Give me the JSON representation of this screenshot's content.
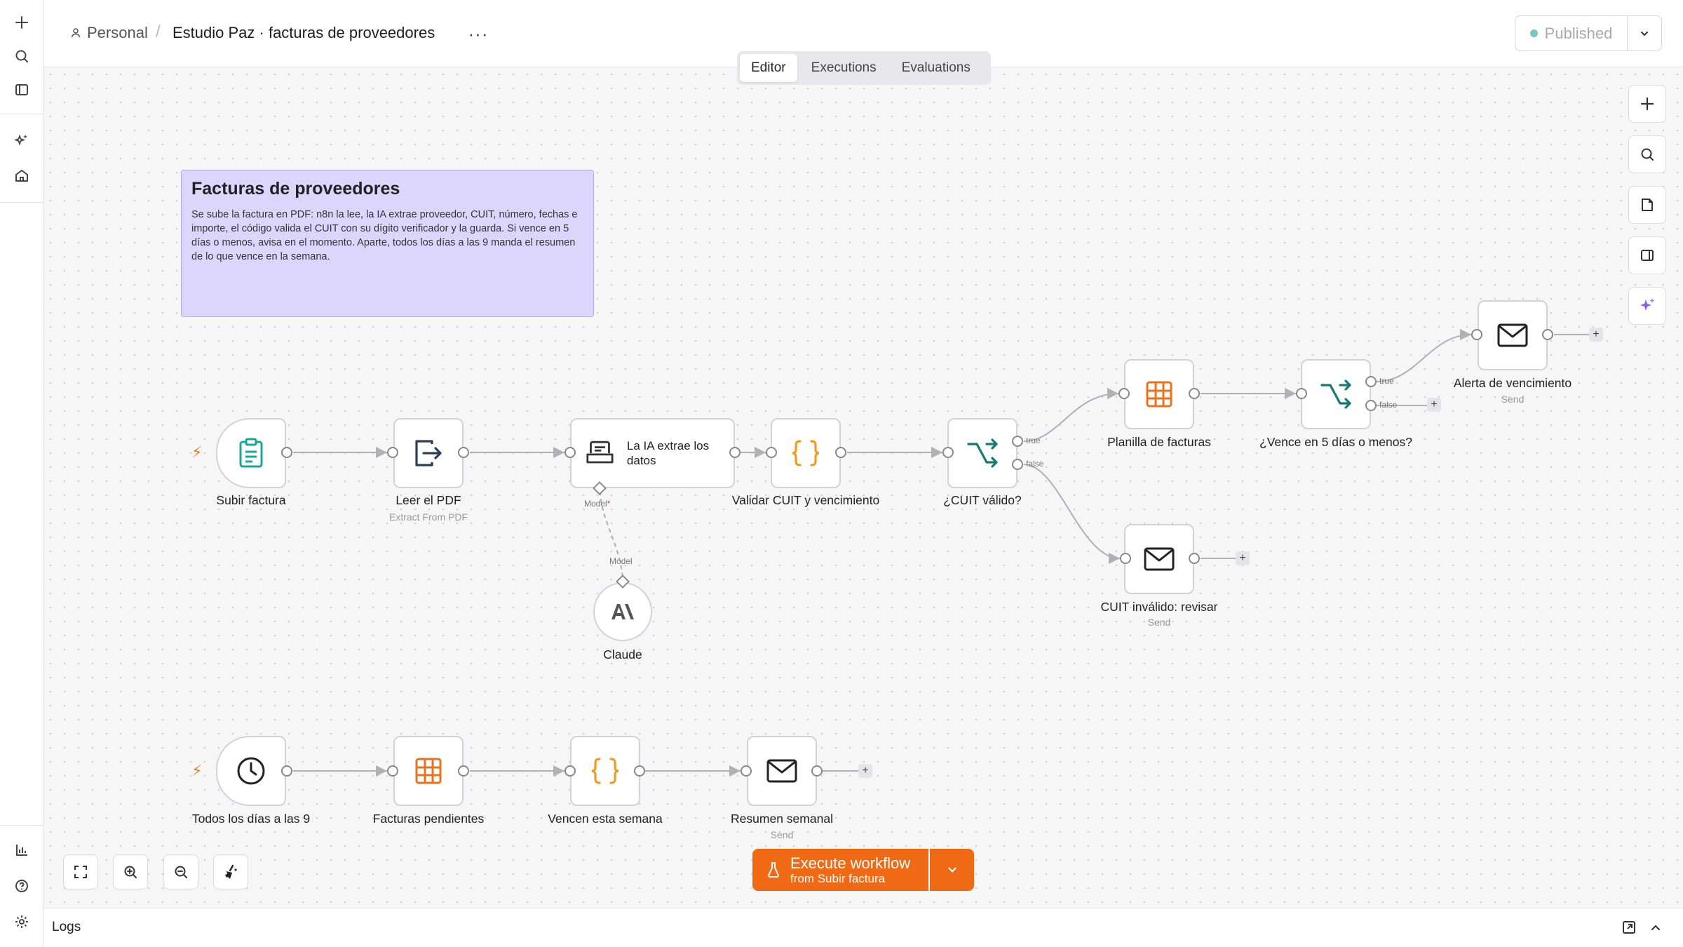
{
  "header": {
    "breadcrumb_personal": "Personal",
    "breadcrumb_sep": "/",
    "workflow_title": "Estudio Paz · facturas de proveedores",
    "more_label": "···",
    "publish_label": "Published"
  },
  "tabs": [
    {
      "label": "Editor",
      "active": true
    },
    {
      "label": "Executions",
      "active": false
    },
    {
      "label": "Evaluations",
      "active": false
    }
  ],
  "sticky": {
    "title": "Facturas de proveedores",
    "body": "Se sube la factura en PDF: n8n la lee, la IA extrae proveedor, CUIT, número, fechas e importe, el código valida el CUIT con su dígito verificador y la guarda. Si vence en 5 días o menos, avisa en el momento. Aparte, todos los días a las 9 manda el resumen de lo que vence en la semana."
  },
  "nodes": {
    "subir_factura": {
      "label": "Subir factura",
      "icon": "clipboard-icon"
    },
    "leer_pdf": {
      "label": "Leer el PDF",
      "sub": "Extract From PDF",
      "icon": "file-export-icon"
    },
    "ia_extrae": {
      "label": "La IA extrae los datos",
      "icon": "robot-icon"
    },
    "validar_cuit": {
      "label": "Validar CUIT y vencimiento",
      "icon": "code-braces-icon"
    },
    "cuit_valido": {
      "label": "¿CUIT válido?",
      "icon": "if-branch-icon"
    },
    "planilla": {
      "label": "Planilla de facturas",
      "icon": "table-icon"
    },
    "vence_5": {
      "label": "¿Vence en 5 días o menos?",
      "icon": "if-branch-icon"
    },
    "alerta": {
      "label": "Alerta de vencimiento",
      "sub": "Send",
      "icon": "mail-icon"
    },
    "cuit_invalido": {
      "label": "CUIT inválido: revisar",
      "sub": "Send",
      "icon": "mail-icon"
    },
    "claude": {
      "label": "Claude",
      "icon": "anthropic-icon"
    },
    "todos_dias": {
      "label": "Todos los días a las 9",
      "icon": "clock-icon"
    },
    "facturas_pend": {
      "label": "Facturas pendientes",
      "icon": "table-icon"
    },
    "vencen_semana": {
      "label": "Vencen esta semana",
      "icon": "code-braces-icon"
    },
    "resumen": {
      "label": "Resumen semanal",
      "sub": "Send",
      "icon": "mail-icon"
    }
  },
  "edge_labels": {
    "true": "true",
    "false": "false",
    "model_required": "Model",
    "model_required_mark": "*",
    "model": "Model"
  },
  "execute": {
    "title": "Execute workflow",
    "subtitle": "from Subir factura"
  },
  "logs": {
    "label": "Logs"
  },
  "colors": {
    "accent": "#f06a15",
    "sticky_bg": "#dcd6fc",
    "teal": "#1aa79a",
    "orange_icon": "#e8731f",
    "dark_teal": "#147a73"
  }
}
